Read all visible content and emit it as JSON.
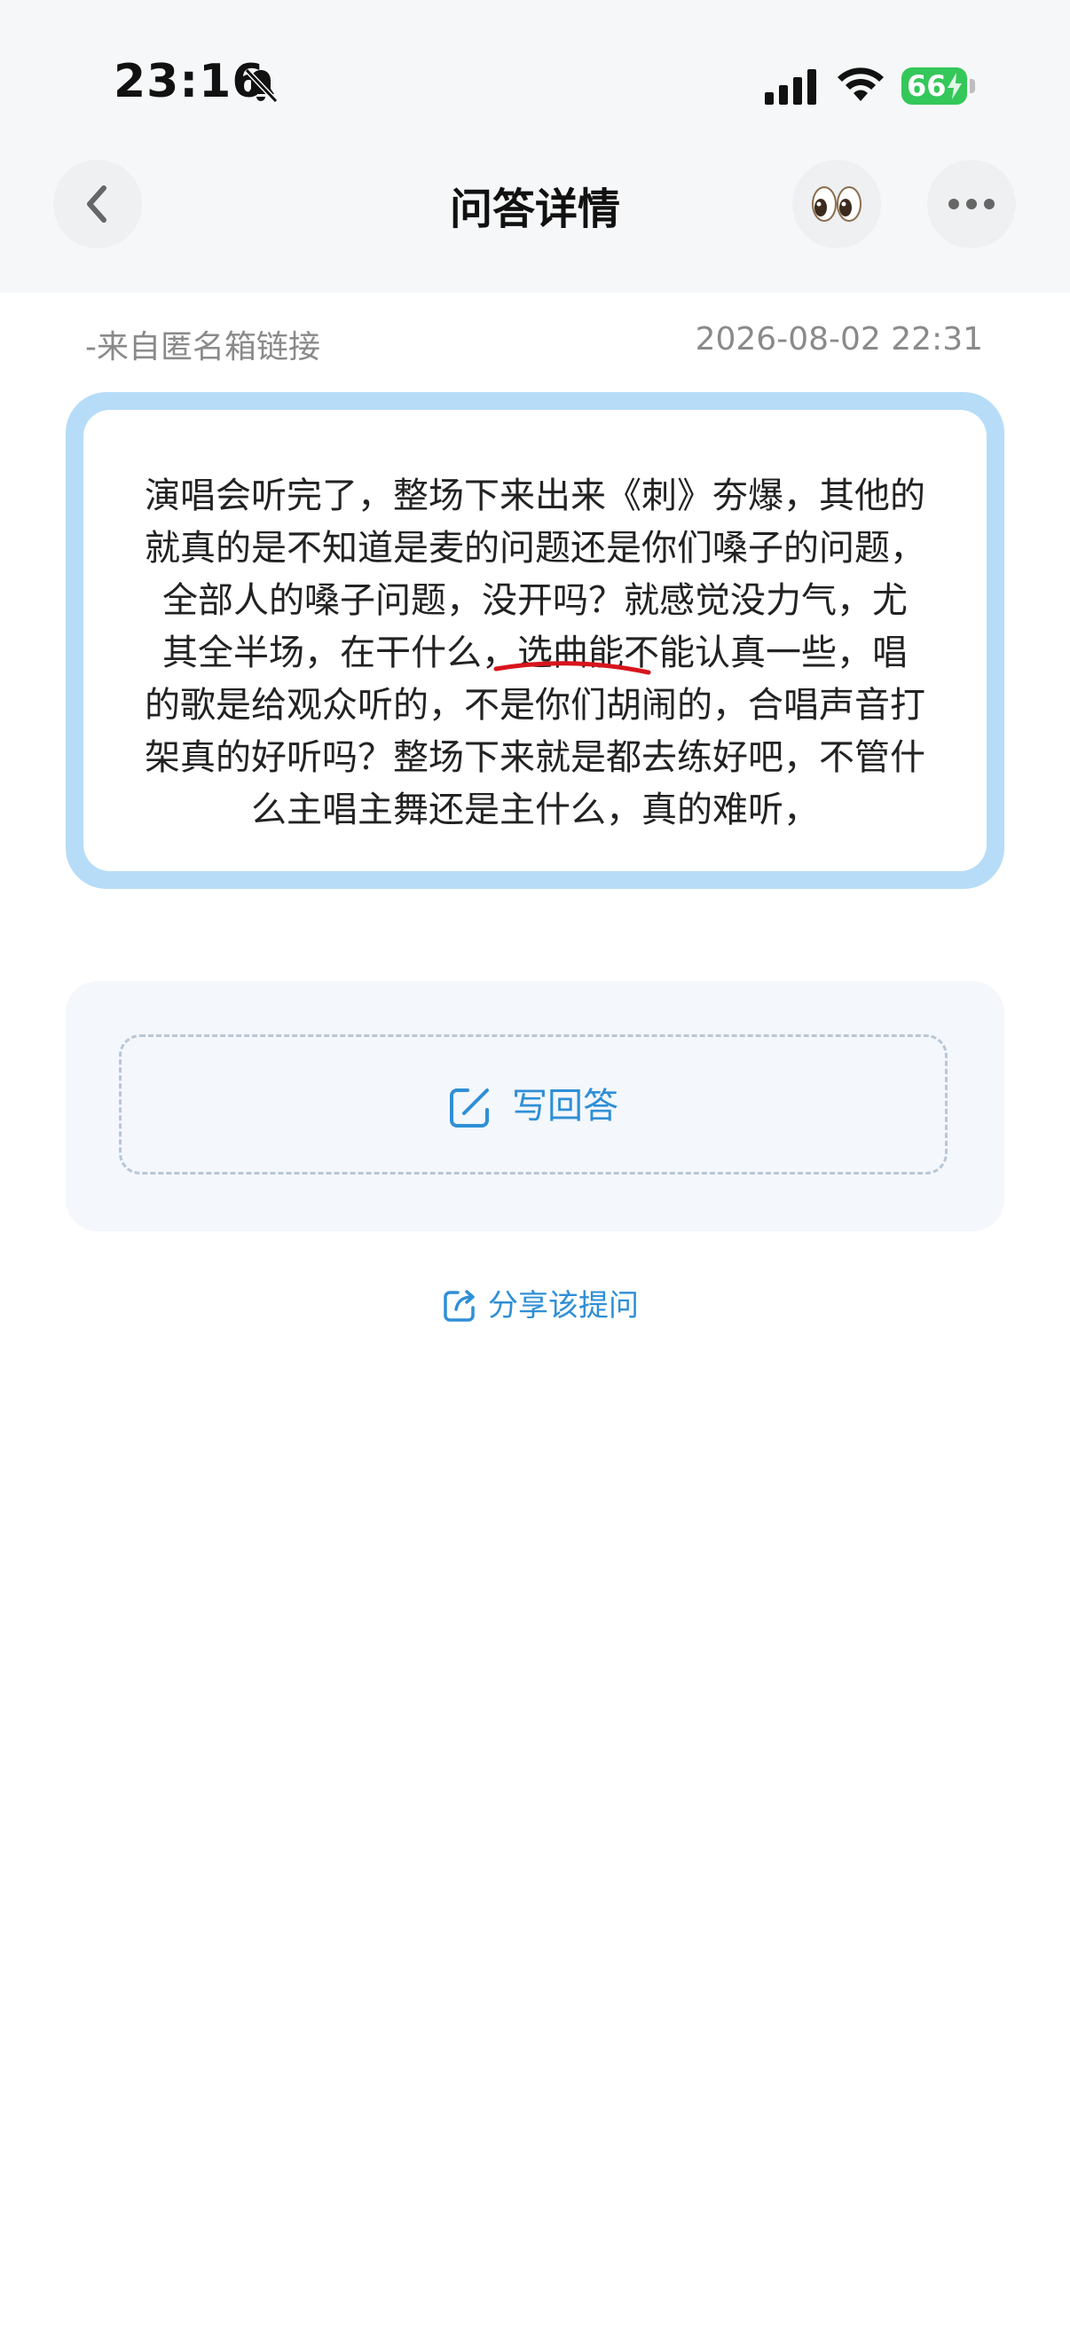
{
  "status_bar": {
    "time": "23:16",
    "battery": "66",
    "icons": [
      "bell-slash-icon",
      "signal-icon",
      "wifi-icon",
      "battery-charging-icon"
    ]
  },
  "nav": {
    "title": "问答详情",
    "icons": [
      "chevron-left-icon",
      "eyes-icon",
      "more-dots-icon"
    ]
  },
  "meta": {
    "source": "-来自匿名箱链接",
    "date": "2026-08-02 22:31"
  },
  "question": {
    "lines": [
      "演唱会听完了，整场下来出来《刺》夯爆，其他的",
      "就真的是不知道是麦的问题还是你们嗓子的问题，",
      "全部人的嗓子问题，没开吗？就感觉没力气，尤",
      "其全半场，在干什么，选曲能不能认真一些，唱",
      "的歌是给观众听的，不是你们胡闹的，合唱声音打",
      "架真的好听吗？整场下来就是都去练好吧，不管什",
      "么主唱主舞还是主什么，真的难听，"
    ]
  },
  "answer": {
    "write_label": "写回答"
  },
  "share": {
    "label": "分享该提问"
  },
  "colors": {
    "accent": "#2f8fd6",
    "card_border": "#b6dcf8",
    "battery": "#34c759",
    "underline": "#d8141c"
  }
}
